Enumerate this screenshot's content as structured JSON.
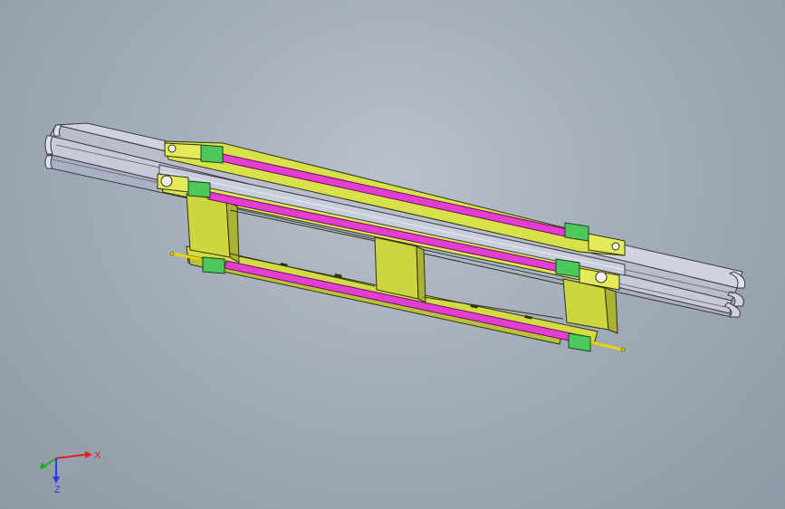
{
  "viewport": {
    "background_top": "#b8c1cc",
    "background_bottom": "#8e99a6"
  },
  "model": {
    "rail_color": "#c6cbd9",
    "frame_color": "#d8e04a",
    "frame_dark": "#9ea62c",
    "magenta_color": "#e23fd0",
    "clamp_color": "#4cc95a"
  },
  "triad": {
    "x_label": "X",
    "z_label": "Z",
    "x_color": "#e02020",
    "y_color": "#20b020",
    "z_color": "#2040e0"
  }
}
